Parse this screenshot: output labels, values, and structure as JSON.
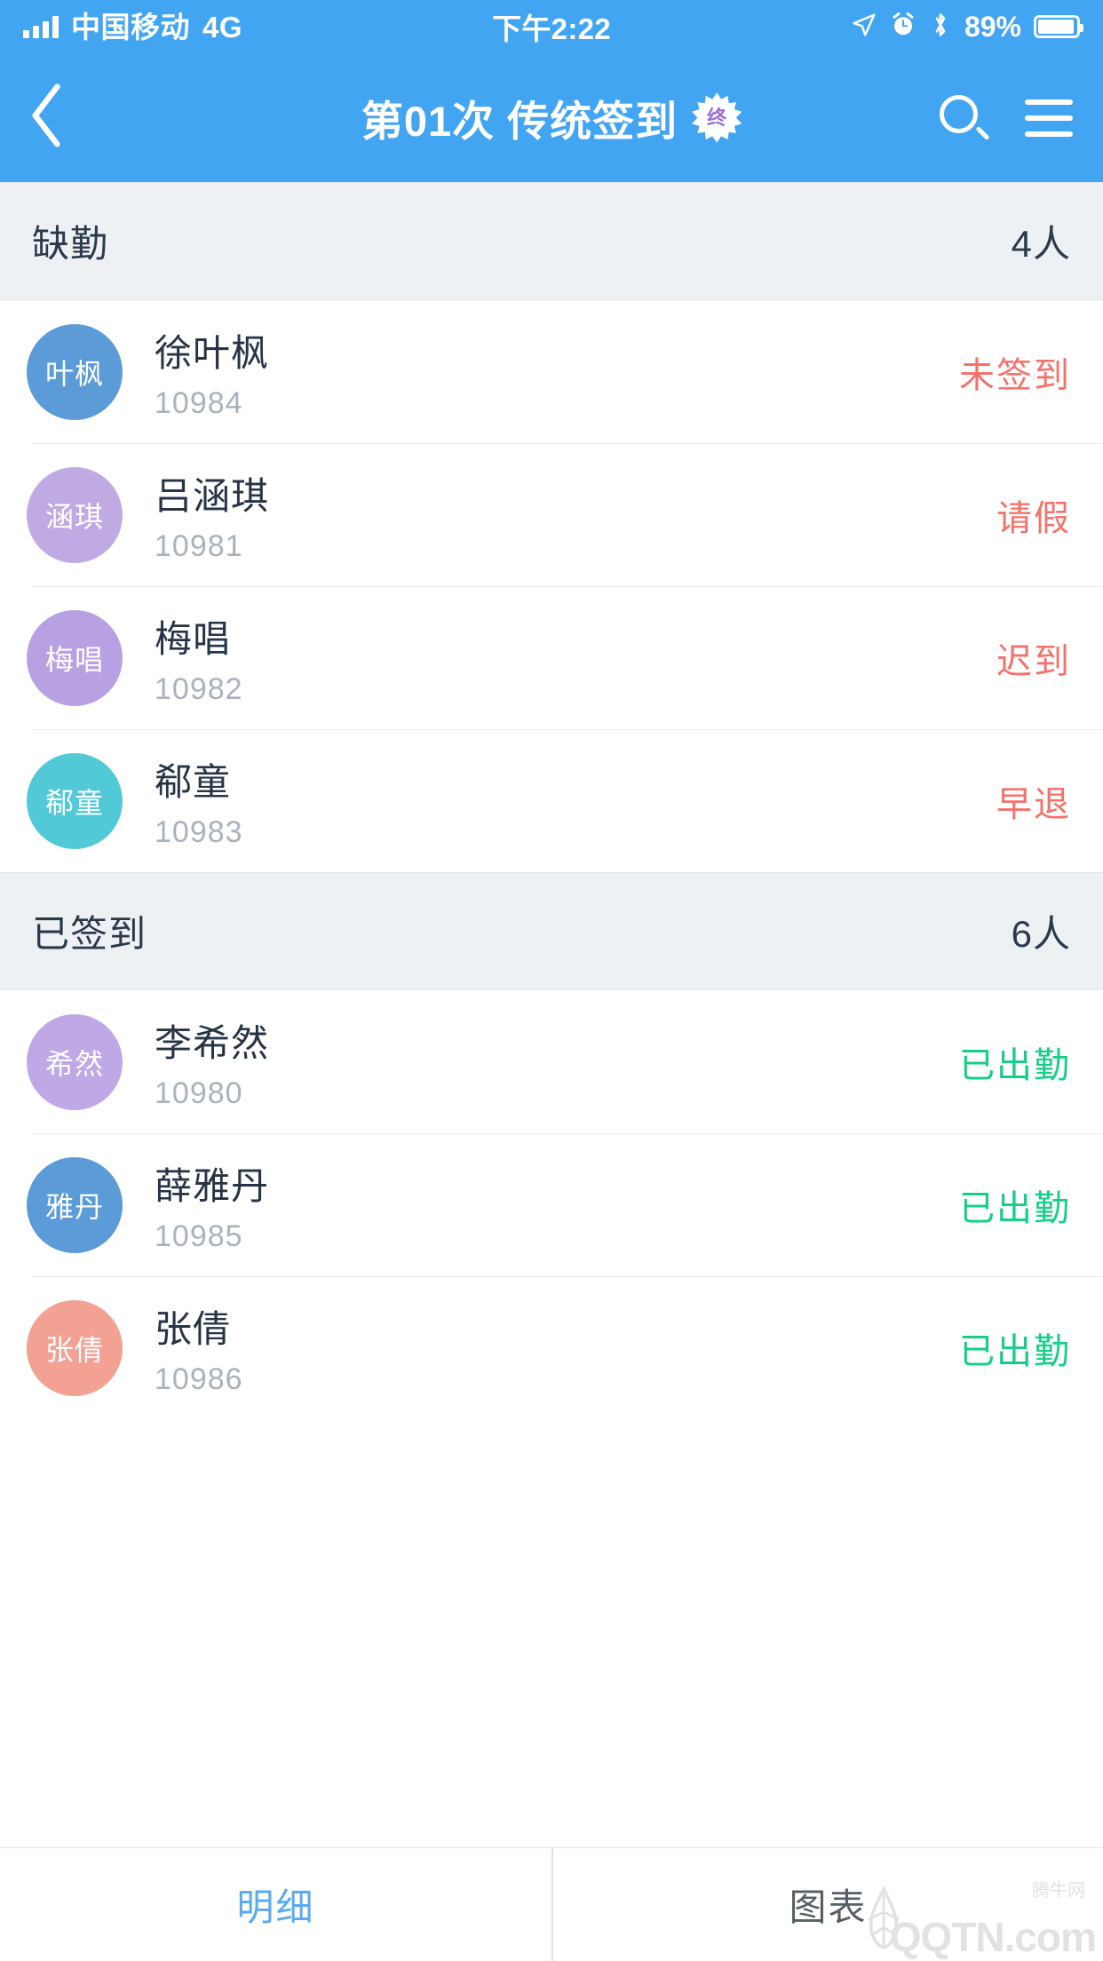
{
  "status_bar": {
    "signal_icon": "signal-bars-icon",
    "carrier": "中国移动",
    "network": "4G",
    "time": "下午2:22",
    "location_icon": "location-arrow-icon",
    "alarm_icon": "alarm-clock-icon",
    "bluetooth_icon": "bluetooth-icon",
    "battery_percent": "89%",
    "battery_icon": "battery-icon"
  },
  "navbar": {
    "back_icon": "chevron-left-icon",
    "title": "第01次 传统签到",
    "badge": "终",
    "badge_icon": "starburst-badge-icon",
    "search_icon": "search-icon",
    "menu_icon": "list-menu-icon"
  },
  "sections": [
    {
      "title": "缺勤",
      "count": "4人",
      "rows": [
        {
          "avatar_text": "叶枫",
          "avatar_color": "#5b9bd8",
          "name": "徐叶枫",
          "id": "10984",
          "status": "未签到",
          "status_color": "#f4726b"
        },
        {
          "avatar_text": "涵琪",
          "avatar_color": "#c0aae4",
          "name": "吕涵琪",
          "id": "10981",
          "status": "请假",
          "status_color": "#f4726b"
        },
        {
          "avatar_text": "梅唱",
          "avatar_color": "#b8a1e3",
          "name": "梅唱",
          "id": "10982",
          "status": "迟到",
          "status_color": "#f4726b"
        },
        {
          "avatar_text": "郗童",
          "avatar_color": "#52c9d6",
          "name": "郗童",
          "id": "10983",
          "status": "早退",
          "status_color": "#f4726b"
        }
      ]
    },
    {
      "title": "已签到",
      "count": "6人",
      "rows": [
        {
          "avatar_text": "希然",
          "avatar_color": "#bfa8e6",
          "name": "李希然",
          "id": "10980",
          "status": "已出勤",
          "status_color": "#15cf86"
        },
        {
          "avatar_text": "雅丹",
          "avatar_color": "#5b9bd8",
          "name": "薛雅丹",
          "id": "10985",
          "status": "已出勤",
          "status_color": "#15cf86"
        },
        {
          "avatar_text": "张倩",
          "avatar_color": "#f3a193",
          "name": "张倩",
          "id": "10986",
          "status": "已出勤",
          "status_color": "#15cf86"
        }
      ]
    }
  ],
  "tabbar": {
    "tabs": [
      {
        "label": "明细",
        "active": true
      },
      {
        "label": "图表",
        "active": false
      }
    ]
  },
  "watermark": {
    "brand": "QQTN.com",
    "sub": "腾牛网"
  },
  "theme": {
    "accent": "#42a5f2",
    "section_bg": "#eef1f4",
    "danger": "#f4726b",
    "success": "#15cf86",
    "tab_active": "#5aaaf0"
  }
}
